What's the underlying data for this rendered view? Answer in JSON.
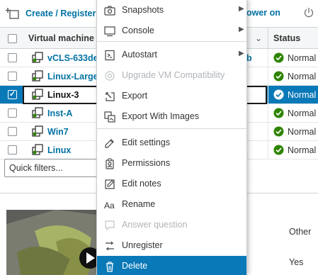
{
  "toolbar": {
    "create_label": "Create / Register VM",
    "power_label": "ower on"
  },
  "grid": {
    "col_name": "Virtual machine",
    "col_status": "Status",
    "rows": [
      {
        "name": "vCLS-633de",
        "tail": "b",
        "status": "Normal",
        "selected": false
      },
      {
        "name": "Linux-Large",
        "tail": "",
        "status": "Normal",
        "selected": false
      },
      {
        "name": "Linux-3",
        "tail": "",
        "status": "Normal",
        "selected": true
      },
      {
        "name": "Inst-A",
        "tail": "",
        "status": "Normal",
        "selected": false
      },
      {
        "name": "Win7",
        "tail": "",
        "status": "Normal",
        "selected": false
      },
      {
        "name": "Linux",
        "tail": "",
        "status": "Normal",
        "selected": false
      }
    ],
    "quick_filter_placeholder": "Quick filters..."
  },
  "details": {
    "other_value": "Other",
    "yes_value": "Yes"
  },
  "context_menu": {
    "items": [
      {
        "label": "Snapshots",
        "icon": "snapshots-icon",
        "submenu": true,
        "disabled": false
      },
      {
        "label": "Console",
        "icon": "console-icon",
        "submenu": true,
        "disabled": false
      },
      {
        "label": "Autostart",
        "icon": "autostart-icon",
        "submenu": true,
        "disabled": false
      },
      {
        "label": "Upgrade VM Compatibility",
        "icon": "upgrade-icon",
        "submenu": false,
        "disabled": true
      },
      {
        "label": "Export",
        "icon": "export-icon",
        "submenu": false,
        "disabled": false
      },
      {
        "label": "Export With Images",
        "icon": "export-images-icon",
        "submenu": false,
        "disabled": false
      },
      {
        "label": "Edit settings",
        "icon": "edit-settings-icon",
        "submenu": false,
        "disabled": false
      },
      {
        "label": "Permissions",
        "icon": "permissions-icon",
        "submenu": false,
        "disabled": false
      },
      {
        "label": "Edit notes",
        "icon": "edit-notes-icon",
        "submenu": false,
        "disabled": false
      },
      {
        "label": "Rename",
        "icon": "rename-icon",
        "submenu": false,
        "disabled": false
      },
      {
        "label": "Answer question",
        "icon": "answer-question-icon",
        "submenu": false,
        "disabled": true
      },
      {
        "label": "Unregister",
        "icon": "unregister-icon",
        "submenu": false,
        "disabled": false
      },
      {
        "label": "Delete",
        "icon": "delete-icon",
        "submenu": false,
        "disabled": false,
        "highlighted": true
      }
    ]
  },
  "colors": {
    "accent": "#0072a3",
    "selection": "#0a79b7",
    "ok_green": "#2f8400"
  }
}
